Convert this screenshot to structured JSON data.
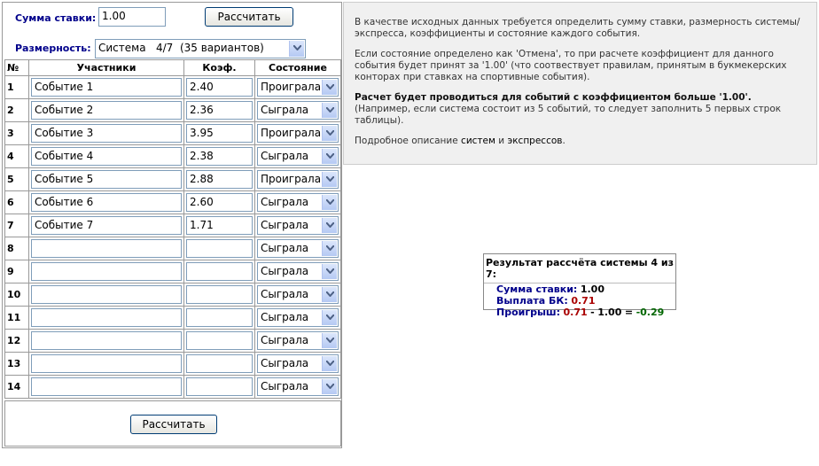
{
  "form": {
    "stake_label": "Сумма ставки:",
    "stake_value": "1.00",
    "calc_button": "Рассчитать",
    "system_label": "Размерность:",
    "system_value": "Система   4/7  (35 вариантов)"
  },
  "table": {
    "headers": [
      "№",
      "Участники",
      "Коэф.",
      "Состояние"
    ],
    "rows": [
      {
        "num": "1",
        "name": "Событие 1",
        "coef": "2.40",
        "state": "Проиграла"
      },
      {
        "num": "2",
        "name": "Событие 2",
        "coef": "2.36",
        "state": "Сыграла"
      },
      {
        "num": "3",
        "name": "Событие 3",
        "coef": "3.95",
        "state": "Проиграла"
      },
      {
        "num": "4",
        "name": "Событие 4",
        "coef": "2.38",
        "state": "Сыграла"
      },
      {
        "num": "5",
        "name": "Событие 5",
        "coef": "2.88",
        "state": "Проиграла"
      },
      {
        "num": "6",
        "name": "Событие 6",
        "coef": "2.60",
        "state": "Сыграла"
      },
      {
        "num": "7",
        "name": "Событие 7",
        "coef": "1.71",
        "state": "Сыграла"
      },
      {
        "num": "8",
        "name": "",
        "coef": "",
        "state": "Сыграла"
      },
      {
        "num": "9",
        "name": "",
        "coef": "",
        "state": "Сыграла"
      },
      {
        "num": "10",
        "name": "",
        "coef": "",
        "state": "Сыграла"
      },
      {
        "num": "11",
        "name": "",
        "coef": "",
        "state": "Сыграла"
      },
      {
        "num": "12",
        "name": "",
        "coef": "",
        "state": "Сыграла"
      },
      {
        "num": "13",
        "name": "",
        "coef": "",
        "state": "Сыграла"
      },
      {
        "num": "14",
        "name": "",
        "coef": "",
        "state": "Сыграла"
      }
    ],
    "bottom_button": "Рассчитать"
  },
  "info": {
    "p1": "В качестве исходных данных требуется определить сумму ставки, размерность системы/экспресса, коэффициенты и состояние каждого события.",
    "p2": "Если состояние определено как 'Отмена', то при расчете коэффициент для данного события будет принят за '1.00' (что соотвествует правилам, принятым в букмекерских конторах при ставках на спортивные события).",
    "p3_bold": "Расчет будет проводиться для событий с коэффициентом больше '1.00'.",
    "p3_rest": "(Например, если система состоит из 5 событий, то следует заполнить 5 первых строк таблицы).",
    "p4_prefix": "Подробное описание",
    "p4_link1": "систем",
    "p4_mid": "и",
    "p4_link2": "экспрессов",
    "p4_end": "."
  },
  "result": {
    "title": "Результат рассчёта системы 4 из 7:",
    "stake_label": "Сумма ставки:",
    "stake_value": "1.00",
    "payout_label": "Выплата БК:",
    "payout_value": "0.71",
    "loss_label": "Проигрыш:",
    "loss_payout": "0.71",
    "loss_minus": "-",
    "loss_stake": "1.00",
    "loss_eq": "=",
    "loss_value": "-0.29"
  },
  "icons": {
    "dropdown": "chevron-down-icon"
  }
}
